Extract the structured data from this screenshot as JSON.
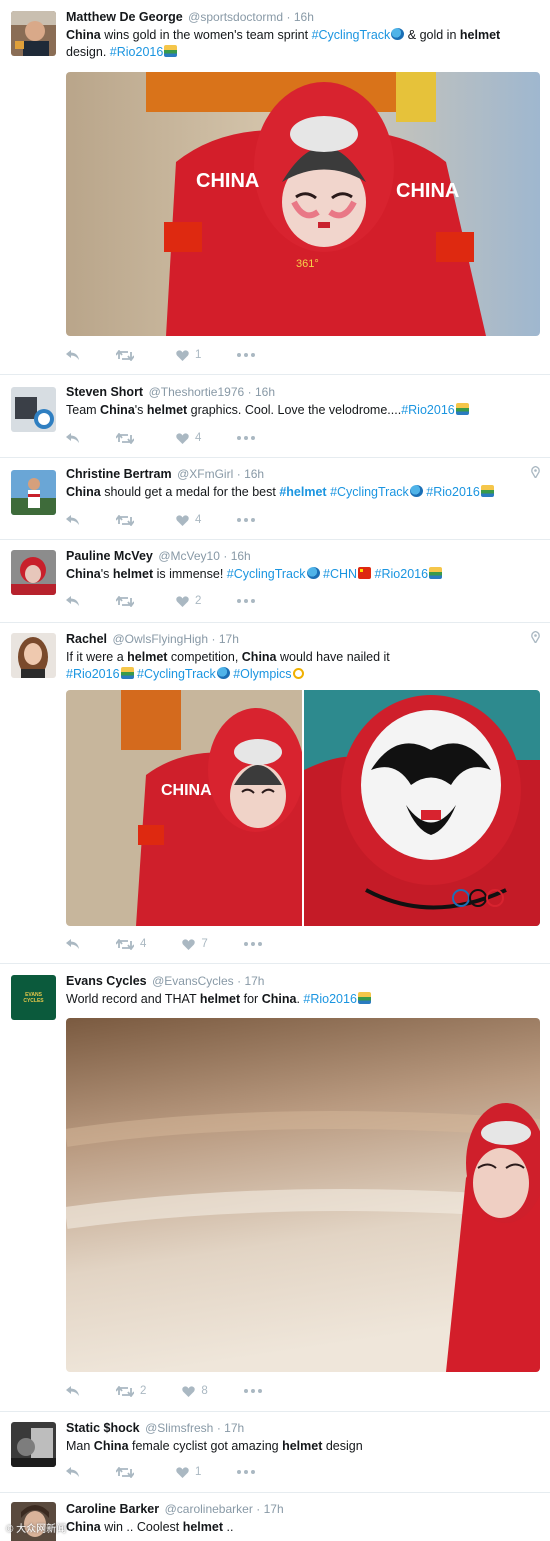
{
  "tweets": [
    {
      "name": "Matthew De George",
      "handle": "@sportsdoctormd",
      "time": "· 16h",
      "text_parts": [
        "China",
        " wins gold in the women's team sprint ",
        "#CyclingTrack",
        " & gold in ",
        "helmet",
        " design. ",
        "#Rio2016"
      ],
      "retweets": "",
      "likes": "1"
    },
    {
      "name": "Steven Short",
      "handle": "@Theshortie1976",
      "time": "· 16h",
      "text_parts": [
        "Team ",
        "China",
        "'s ",
        "helmet",
        " graphics. Cool. Love the velodrome....",
        "#Rio2016"
      ],
      "retweets": "",
      "likes": "4"
    },
    {
      "name": "Christine Bertram",
      "handle": "@XFmGirl",
      "time": "· 16h",
      "text_parts": [
        "China",
        " should get a medal for the best ",
        "#helmet",
        " ",
        "#CyclingTrack",
        " ",
        "#Rio2016"
      ],
      "retweets": "",
      "likes": "4"
    },
    {
      "name": "Pauline McVey",
      "handle": "@McVey10",
      "time": "· 16h",
      "text_parts": [
        "China",
        "'s ",
        "helmet",
        " is immense! ",
        "#CyclingTrack",
        " ",
        "#CHN",
        " ",
        "#Rio2016"
      ],
      "retweets": "",
      "likes": "2"
    },
    {
      "name": "Rachel",
      "handle": "@OwlsFlyingHigh",
      "time": "· 17h",
      "text_parts": [
        "If it were a ",
        "helmet",
        " competition, ",
        "China",
        " would have nailed it",
        "#Rio2016",
        " ",
        "#CyclingTrack",
        " ",
        "#Olympics"
      ],
      "retweets": "4",
      "likes": "7"
    },
    {
      "name": "Evans Cycles",
      "handle": "@EvansCycles",
      "time": "· 17h",
      "text_parts": [
        "World record and THAT ",
        "helmet",
        " for ",
        "China",
        ". ",
        "#Rio2016"
      ],
      "retweets": "2",
      "likes": "8",
      "avatar_text": "EVANS CYCLES"
    },
    {
      "name": "Static $hock",
      "handle": "@Slimsfresh",
      "time": "· 17h",
      "text_parts": [
        "Man ",
        "China",
        " female cyclist got amazing ",
        "helmet",
        " design"
      ],
      "retweets": "",
      "likes": "1"
    },
    {
      "name": "Caroline Barker",
      "handle": "@carolinebarker",
      "time": "· 17h",
      "text_parts": [
        "China",
        " win .. Coolest ",
        "helmet",
        " .."
      ]
    }
  ],
  "photo_text": {
    "jersey": "CHINA",
    "jersey_small": "361°"
  },
  "watermark": "© 大众网新闻",
  "colors": {
    "accent": "#1b95e0",
    "muted": "#8899a6",
    "action": "#aab8c2",
    "jersey_red": "#d91e2a",
    "evans_green": "#0b5a3c"
  }
}
